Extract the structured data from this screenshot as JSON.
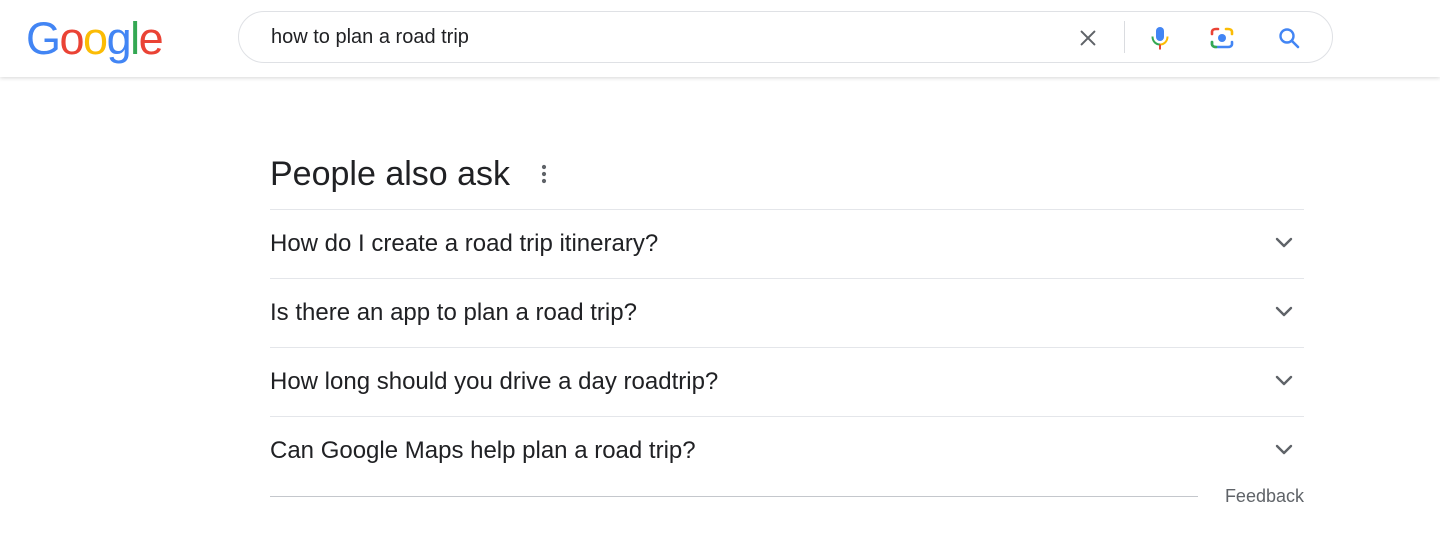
{
  "logo": {
    "letters": [
      "G",
      "o",
      "o",
      "g",
      "l",
      "e"
    ],
    "colors": [
      "#4285F4",
      "#EA4335",
      "#FBBC05",
      "#4285F4",
      "#34A853",
      "#EA4335"
    ]
  },
  "search": {
    "value": "how to plan a road trip",
    "icons": [
      "close-icon",
      "microphone-icon",
      "camera-lens-icon",
      "search-icon"
    ],
    "accent": "#4285F4"
  },
  "paa": {
    "title": "People also ask",
    "more_icon": "vertical-dots-icon",
    "questions": [
      "How do I create a road trip itinerary?",
      "Is there an app to plan a road trip?",
      "How long should you drive a day roadtrip?",
      "Can Google Maps help plan a road trip?"
    ],
    "expand_icon": "chevron-down-icon"
  },
  "footer": {
    "feedback_label": "Feedback"
  }
}
